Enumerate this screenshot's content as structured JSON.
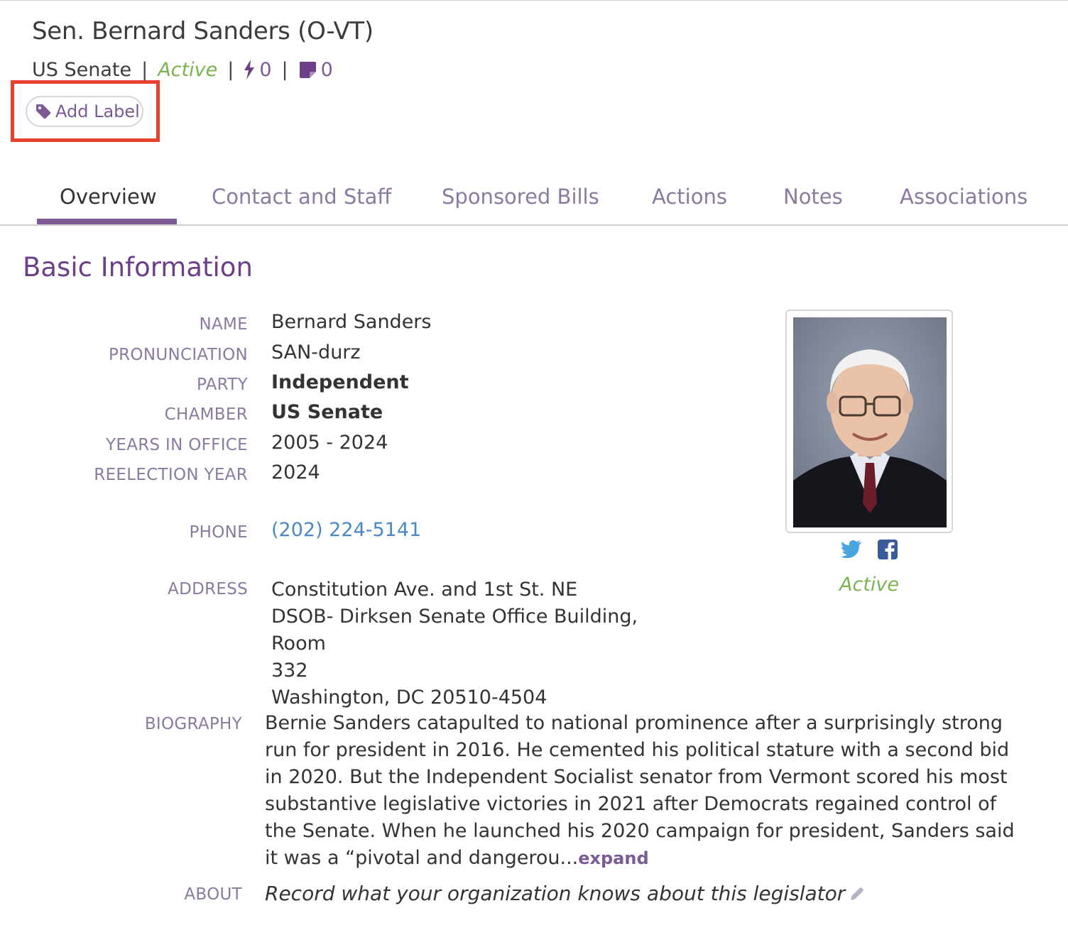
{
  "header": {
    "title": "Sen. Bernard Sanders (O-VT)",
    "chamber": "US Senate",
    "status": "Active",
    "actions_count": "0",
    "notes_count": "0",
    "separator": "|"
  },
  "label_button": {
    "label": "Add Label",
    "icon": "tag-icon"
  },
  "tabs": [
    {
      "label": "Overview"
    },
    {
      "label": "Contact and Staff"
    },
    {
      "label": "Sponsored Bills"
    },
    {
      "label": "Actions"
    },
    {
      "label": "Notes"
    },
    {
      "label": "Associations"
    }
  ],
  "basic_info": {
    "title": "Basic Information",
    "fields": {
      "name": {
        "label": "NAME",
        "value": "Bernard Sanders"
      },
      "pronunciation": {
        "label": "PRONUNCIATION",
        "value": "SAN-durz"
      },
      "party": {
        "label": "PARTY",
        "value": "Independent"
      },
      "chamber": {
        "label": "CHAMBER",
        "value": "US Senate"
      },
      "years_in_office": {
        "label": "YEARS IN OFFICE",
        "value": "2005 - 2024"
      },
      "reelection_year": {
        "label": "REELECTION YEAR",
        "value": "2024"
      },
      "phone": {
        "label": "PHONE",
        "value": "(202) 224-5141"
      },
      "address": {
        "label": "ADDRESS",
        "lines": [
          "Constitution Ave. and 1st St. NE",
          "DSOB- Dirksen Senate Office Building, Room",
          "332",
          "Washington, DC 20510-4504"
        ]
      }
    },
    "photo_status": "Active"
  },
  "biography": {
    "label": "BIOGRAPHY",
    "text": "Bernie Sanders catapulted to national prominence after a surprisingly strong run for president in 2016. He cemented his political stature with a second bid in 2020. But the Independent Socialist senator from Vermont scored his most substantive legislative victories in 2021 after Democrats regained control of the Senate. When he launched his 2020 campaign for president, Sanders said it was a “pivotal and dangerou...",
    "expand_label": "expand"
  },
  "about": {
    "label": "ABOUT",
    "placeholder": "Record what your organization knows about this legislator"
  },
  "colors": {
    "accent": "#7b5a96",
    "heading": "#6d3f88",
    "active": "#7cb351",
    "link": "#4a88c8",
    "highlight": "#e8412b",
    "twitter": "#4aa4e0",
    "facebook": "#3b5a9a"
  }
}
